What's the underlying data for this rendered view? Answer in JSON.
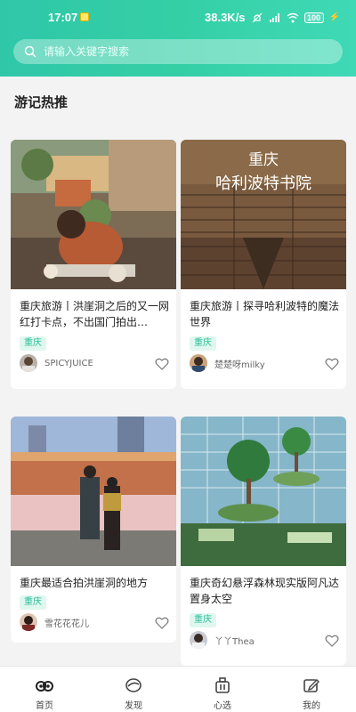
{
  "status": {
    "time": "17:07",
    "network_speed": "38.3K/s",
    "battery": "100"
  },
  "search": {
    "placeholder": "请输入关键字搜索"
  },
  "section": {
    "title": "游记热推"
  },
  "cards": [
    {
      "title": "重庆旅游丨洪崖洞之后的又一网红打卡点，不出国门拍出…",
      "tag": "重庆",
      "author": "SPICYJUICE",
      "image_icon": "travel-photo-woman-dining",
      "image_text": ""
    },
    {
      "title": "重庆旅游丨探寻哈利波特的魔法世界",
      "tag": "重庆",
      "author": "楚楚呀milky",
      "image_icon": "library-bookshelves",
      "image_text_line1": "重庆",
      "image_text_line2": "哈利波特书院"
    },
    {
      "title": "重庆最适合拍洪崖洞的地方",
      "tag": "重庆",
      "author": "雪花花花儿",
      "image_icon": "couple-riverside-hongyadong",
      "image_text": ""
    },
    {
      "title": "重庆奇幻悬浮森林现实版阿凡达置身太空",
      "tag": "重庆",
      "author": "丫丫Thea",
      "image_icon": "glass-dome-forest",
      "image_text": ""
    }
  ],
  "bottom_nav": [
    {
      "label": "首页",
      "icon": "binoculars-icon"
    },
    {
      "label": "发现",
      "icon": "discover-icon"
    },
    {
      "label": "心选",
      "icon": "luggage-icon"
    },
    {
      "label": "我的",
      "icon": "edit-icon"
    }
  ],
  "colors": {
    "accent": "#2fc7a8",
    "tag_bg": "#dff7ef",
    "tag_text": "#2cbf98"
  }
}
